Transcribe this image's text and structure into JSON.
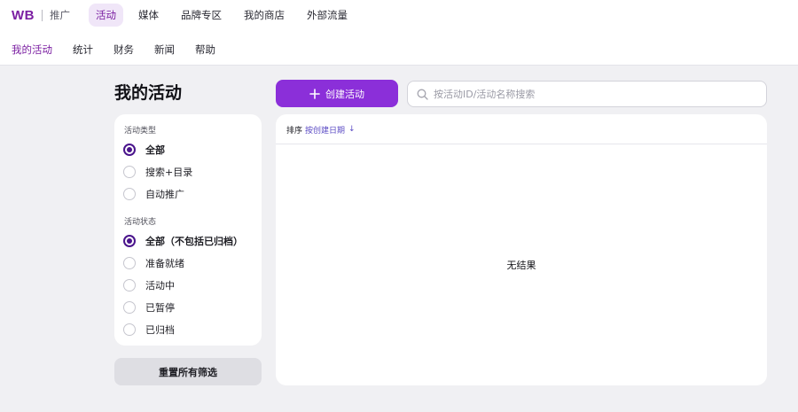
{
  "header": {
    "logo": {
      "brand": "WB",
      "suffix": "推广"
    },
    "top_nav": [
      {
        "label": "活动",
        "active": true
      },
      {
        "label": "媒体",
        "active": false
      },
      {
        "label": "品牌专区",
        "active": false
      },
      {
        "label": "我的商店",
        "active": false
      },
      {
        "label": "外部流量",
        "active": false
      }
    ],
    "sub_nav": [
      {
        "label": "我的活动",
        "active": true
      },
      {
        "label": "统计",
        "active": false
      },
      {
        "label": "财务",
        "active": false
      },
      {
        "label": "新闻",
        "active": false
      },
      {
        "label": "帮助",
        "active": false
      }
    ]
  },
  "main": {
    "title": "我的活动",
    "create_button": {
      "label": "创建活动",
      "icon": "plus-icon"
    },
    "search": {
      "value": "",
      "placeholder": "按活动ID/活动名称搜索",
      "icon": "search-icon"
    },
    "filters": {
      "campaign_type": {
        "label": "活动类型",
        "options": [
          {
            "label": "全部",
            "checked": true
          },
          {
            "label": "搜索+目录",
            "checked": false
          },
          {
            "label": "自动推广",
            "checked": false
          }
        ]
      },
      "campaign_status": {
        "label": "活动状态",
        "options": [
          {
            "label": "全部（不包括已归档）",
            "checked": true
          },
          {
            "label": "准备就绪",
            "checked": false
          },
          {
            "label": "活动中",
            "checked": false
          },
          {
            "label": "已暂停",
            "checked": false
          },
          {
            "label": "已归档",
            "checked": false
          }
        ]
      }
    },
    "reset_button": {
      "label": "重置所有筛选"
    },
    "results": {
      "sort_label": "排序",
      "sort_value": "按创建日期",
      "sort_arrow": "↓",
      "empty_text": "无结果"
    }
  },
  "colors": {
    "brand": "#7b1fa2",
    "primary_button": "#8b2fd9",
    "radio_checked": "#4a148c",
    "link": "#5b4bc4",
    "page_background": "#f0f0f3"
  }
}
